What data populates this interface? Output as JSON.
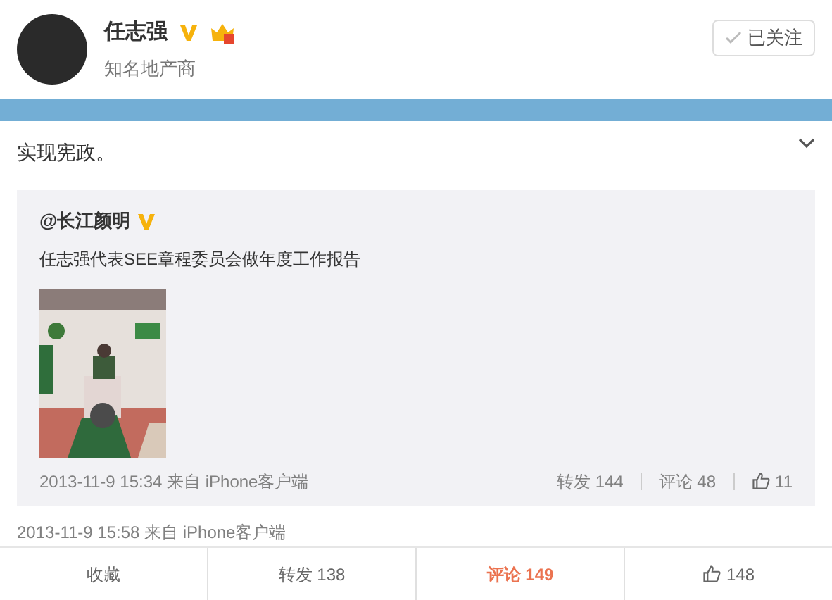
{
  "profile": {
    "name": "任志强",
    "verified": true,
    "bio": "知名地产商",
    "follow_button": "已关注"
  },
  "post": {
    "text": "实现宪政。",
    "repost": {
      "author": "@长江颜明",
      "verified": true,
      "text": "任志强代表SEE章程委员会做年度工作报告",
      "meta": "2013-11-9 15:34 来自 iPhone客户端",
      "actions": [
        {
          "kind": "text",
          "label": "转发 144"
        },
        {
          "kind": "like",
          "label": "11"
        }
      ],
      "comment": "评论 48"
    },
    "meta": "2013-11-9 15:58 来自 iPhone客户端"
  },
  "tabs": [
    {
      "kind": "text",
      "label": "收藏",
      "selected": false
    },
    {
      "kind": "text",
      "label": "转发 138",
      "selected": false
    },
    {
      "kind": "text",
      "label": "评论 149",
      "selected": true
    },
    {
      "kind": "like",
      "label": "148",
      "selected": false
    }
  ]
}
